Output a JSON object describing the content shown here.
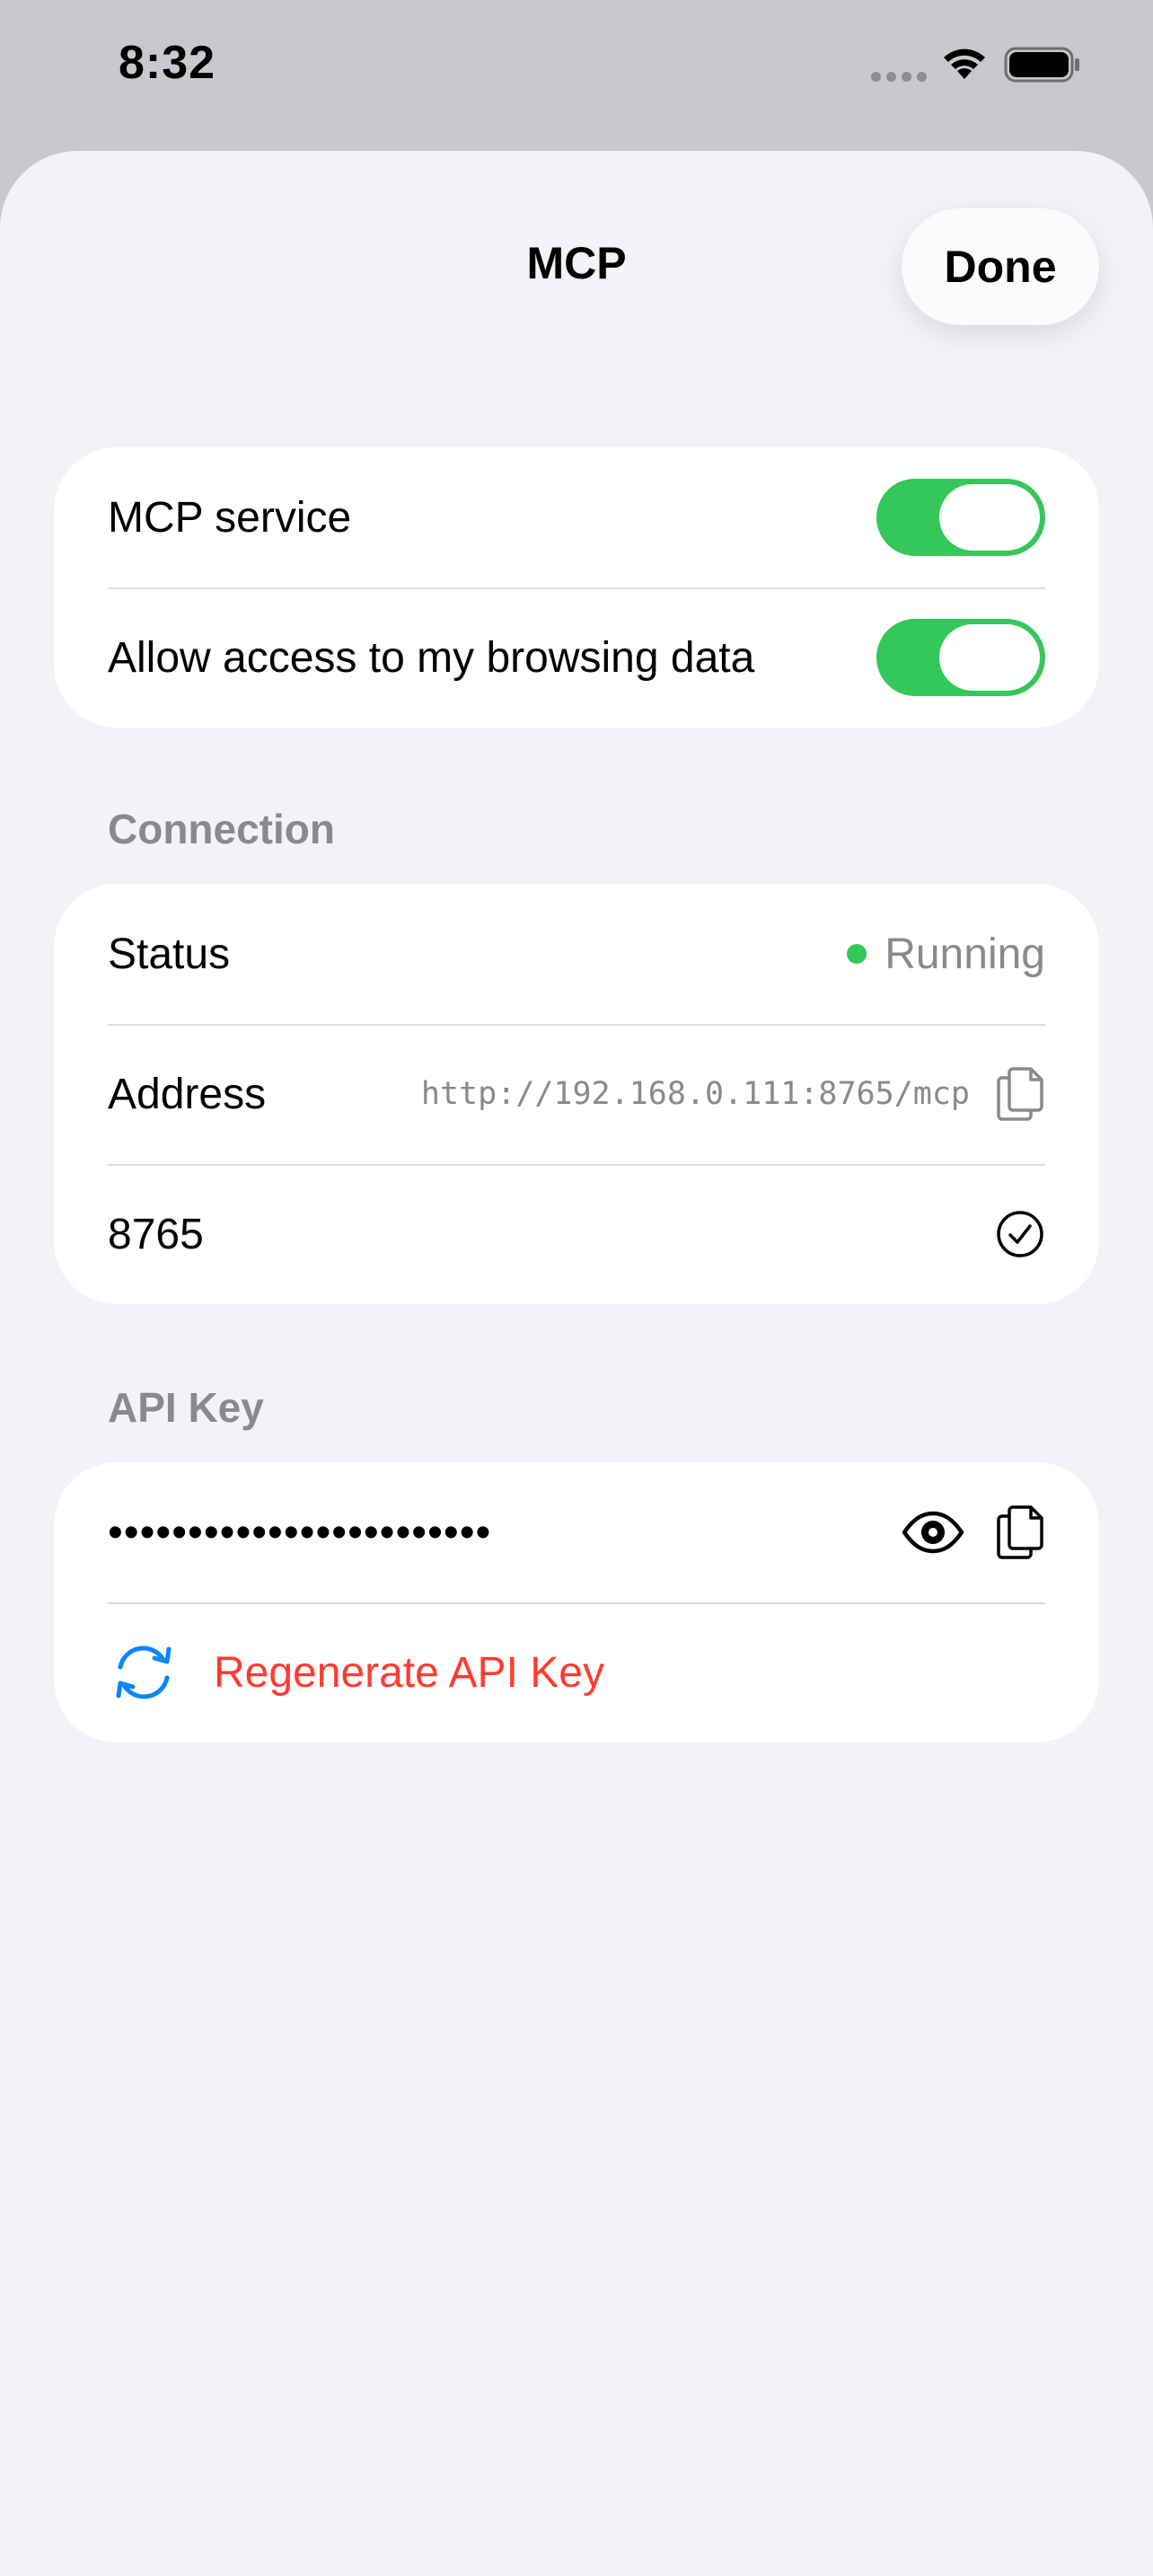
{
  "status_bar": {
    "time": "8:32"
  },
  "sheet": {
    "title": "MCP",
    "done_label": "Done"
  },
  "toggles": {
    "mcp_service": {
      "label": "MCP service",
      "on": true
    },
    "browsing_access": {
      "label": "Allow access to my browsing data",
      "on": true
    }
  },
  "connection": {
    "header": "Connection",
    "status_label": "Status",
    "status_value": "Running",
    "address_label": "Address",
    "address_value": "http://192.168.0.111:8765/mcp",
    "port_value": "8765"
  },
  "api_key": {
    "header": "API Key",
    "masked_value": "••••••••••••••••••••••••",
    "regenerate_label": "Regenerate API Key"
  },
  "colors": {
    "toggle_on": "#34c759",
    "status_running": "#34c759",
    "destructive": "#ff3b30",
    "accent_icon": "#0a84ff",
    "secondary_text": "#8a8a8e",
    "sheet_background": "#f2f2f7"
  },
  "icons": {
    "wifi": "wifi-icon",
    "battery": "battery-icon",
    "copy": "copy-icon",
    "checkmark": "checkmark-circle-icon",
    "eye": "eye-icon",
    "refresh": "refresh-icon"
  }
}
